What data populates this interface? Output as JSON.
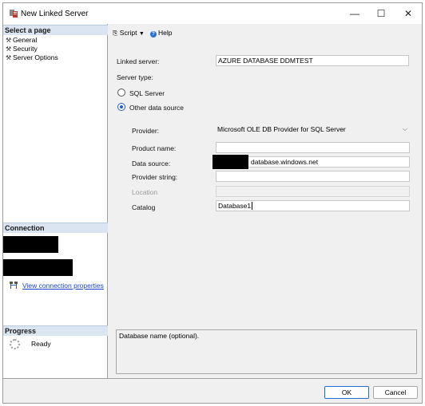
{
  "window": {
    "title": "New Linked Server",
    "minimize_glyph": "—",
    "maximize_glyph": "☐",
    "close_glyph": "✕"
  },
  "sidebar": {
    "select_page_header": "Select a page",
    "pages": [
      {
        "label": "General",
        "icon": "wrench-icon"
      },
      {
        "label": "Security",
        "icon": "wrench-icon"
      },
      {
        "label": "Server Options",
        "icon": "wrench-icon"
      }
    ],
    "connection_header": "Connection",
    "view_connection_properties": "View connection properties",
    "progress_header": "Progress",
    "progress_status": "Ready"
  },
  "toolbar": {
    "script_label": "Script",
    "help_label": "Help"
  },
  "form": {
    "linked_server_label": "Linked server:",
    "linked_server_value": "AZURE DATABASE DDMTEST",
    "server_type_label": "Server type:",
    "sql_server_label": "SQL Server",
    "other_source_label": "Other data source",
    "selected_server_type": "Other data source",
    "provider_label": "Provider:",
    "provider_value": "Microsoft OLE DB Provider for SQL Server",
    "product_name_label": "Product name:",
    "product_name_value": "",
    "data_source_label": "Data source:",
    "data_source_value": "database.windows.net",
    "provider_string_label": "Provider string:",
    "provider_string_value": "",
    "location_label": "Location",
    "location_value": "",
    "catalog_label": "Catalog",
    "catalog_value": "Database1",
    "description": "Database name (optional)."
  },
  "buttons": {
    "ok": "OK",
    "cancel": "Cancel"
  },
  "colors": {
    "section_header_bg": "#dbe5f1",
    "link": "#1a44d6",
    "accent": "#1f5fc2"
  }
}
